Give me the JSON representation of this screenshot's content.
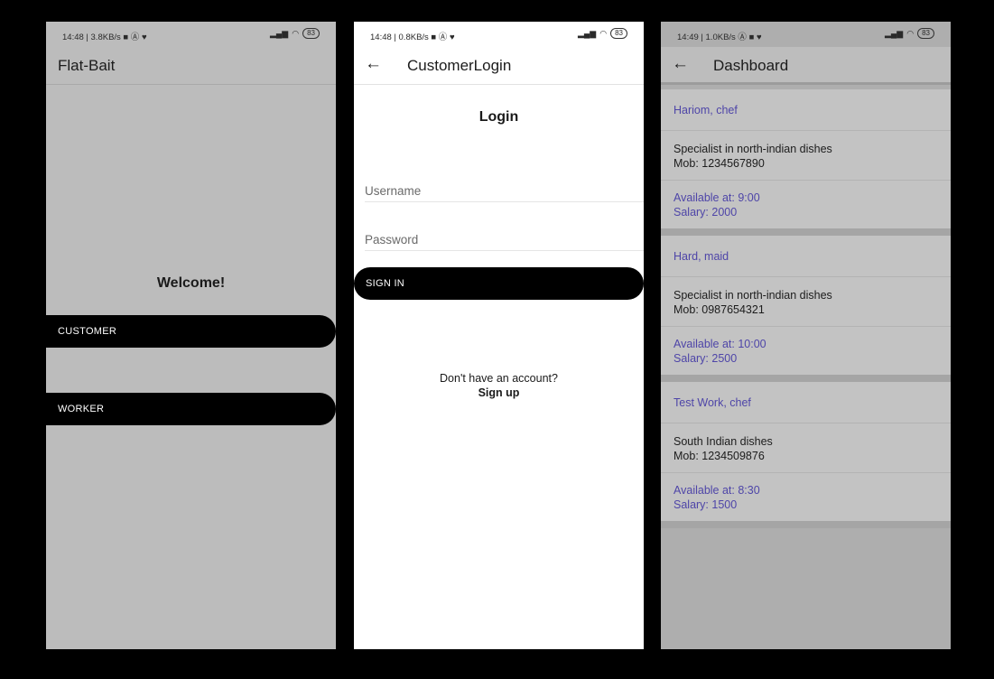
{
  "screens": [
    {
      "status": {
        "time": "14:48 | 3.8KB/s ■ Ⓐ ♥",
        "battery": "83"
      },
      "appbar": {
        "title": "Flat-Bait"
      },
      "welcome": "Welcome!",
      "buttons": {
        "customer": "CUSTOMER",
        "worker": "WORKER"
      }
    },
    {
      "status": {
        "time": "14:48 | 0.8KB/s ■ Ⓐ ♥",
        "battery": "83"
      },
      "appbar": {
        "title": "CustomerLogin",
        "back_icon": "arrow-left-icon"
      },
      "heading": "Login",
      "username": {
        "placeholder": "Username",
        "value": ""
      },
      "password": {
        "placeholder": "Password",
        "value": ""
      },
      "signin_label": "SIGN IN",
      "signup_question": "Don't have an account?",
      "signup_link": "Sign up"
    },
    {
      "status": {
        "time": "14:49 | 1.0KB/s Ⓐ ■ ♥",
        "battery": "83"
      },
      "appbar": {
        "title": "Dashboard",
        "back_icon": "arrow-left-icon"
      },
      "workers": [
        {
          "header": "Hariom, chef",
          "speciality": "Specialist in north-indian dishes",
          "mobile": "Mob: 1234567890",
          "available": "Available at: 9:00",
          "salary": "Salary: 2000"
        },
        {
          "header": "Hard, maid",
          "speciality": "Specialist in north-indian dishes",
          "mobile": "Mob: 0987654321",
          "available": "Available at: 10:00",
          "salary": "Salary: 2500"
        },
        {
          "header": "Test Work, chef",
          "speciality": "South Indian dishes",
          "mobile": "Mob: 1234509876",
          "available": "Available at: 8:30",
          "salary": "Salary: 1500"
        }
      ]
    }
  ],
  "colors": {
    "accent_text": "#4e45a8",
    "button_bg": "#000000",
    "button_text": "#ffffff"
  }
}
